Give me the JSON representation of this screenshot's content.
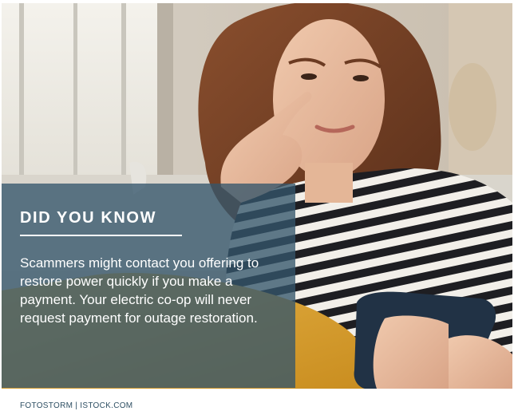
{
  "callout": {
    "heading": "DID YOU KNOW",
    "body": "Scammers might contact you offering to restore power quickly if you make a payment. Your electric co-op will never request payment for outage restoration."
  },
  "photo": {
    "credit": "FOTOSTORM | ISTOCK.COM"
  },
  "colors": {
    "panel": "#34566c",
    "accent_text": "#ffffff",
    "credit_text": "#2e4f63"
  }
}
